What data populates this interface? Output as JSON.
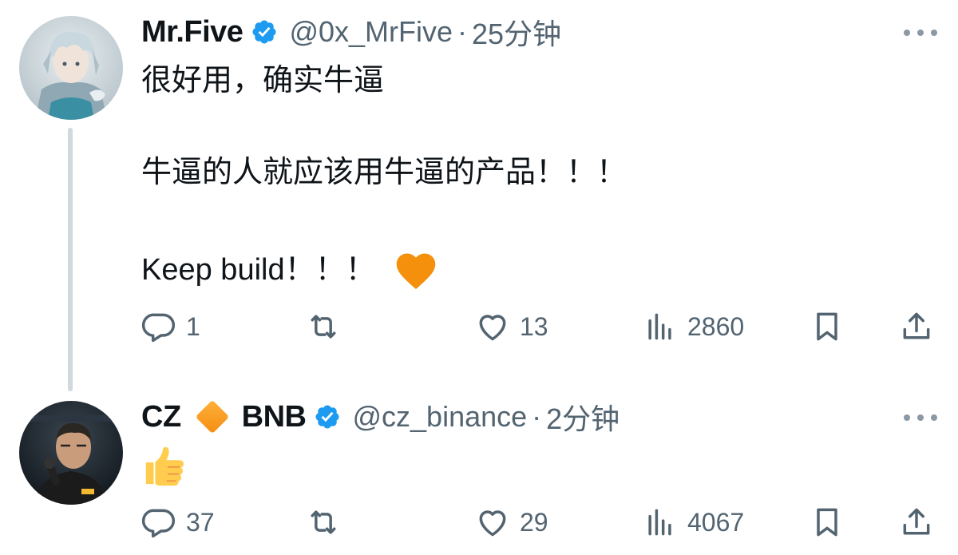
{
  "tweets": [
    {
      "name": "Mr.Five",
      "handle": "@0x_MrFive",
      "separator": "·",
      "time": "25分钟",
      "lines": [
        "很好用，确实牛逼",
        "牛逼的人就应该用牛逼的产品！！！",
        "Keep build！！！"
      ],
      "emoji": "heart-orange",
      "stats": {
        "replies": "1",
        "retweets": "",
        "likes": "13",
        "views": "2860"
      }
    },
    {
      "name": "CZ",
      "name_suffix": "BNB",
      "handle": "@cz_binance",
      "separator": "·",
      "time": "2分钟",
      "emoji": "thumbs-up",
      "stats": {
        "replies": "37",
        "retweets": "",
        "likes": "29",
        "views": "4067"
      }
    }
  ],
  "colors": {
    "accent": "#1d9bf0",
    "secondary_text": "#536471",
    "thread_line": "#cfd9de",
    "heart": "#f4900c",
    "bnb": "#f3a11a"
  }
}
